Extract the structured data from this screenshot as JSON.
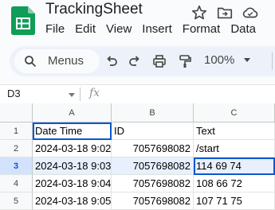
{
  "app": {
    "title": "TrackingSheet",
    "menu": [
      "File",
      "Edit",
      "View",
      "Insert",
      "Format",
      "Data"
    ],
    "header_icons": [
      "star-icon",
      "move-to-folder-icon",
      "cloud-status-icon"
    ]
  },
  "toolbar": {
    "search_label": "Menus",
    "buttons": [
      "undo-icon",
      "redo-icon",
      "print-icon",
      "paint-format-icon"
    ],
    "zoom": "100%"
  },
  "formula_bar": {
    "namebox": "D3",
    "fx": "fx"
  },
  "grid": {
    "columns": [
      "A",
      "B",
      "C"
    ],
    "row_numbers": [
      "1",
      "2",
      "3",
      "4",
      "5"
    ],
    "rows": [
      [
        "Date Time",
        "ID",
        "Text"
      ],
      [
        "2024-03-18 9:02",
        "7057698082",
        "/start"
      ],
      [
        "2024-03-18 9:03",
        "7057698082",
        "114 69 74"
      ],
      [
        "2024-03-18 9:04",
        "7057698082",
        "108 66 72"
      ],
      [
        "2024-03-18 9:05",
        "7057698082",
        "107 71 75"
      ]
    ],
    "active_cell": "D3"
  },
  "colors": {
    "accent": "#0b57d0",
    "logo_green": "#0f9d58",
    "toolbar_bg": "#edf2fa",
    "highlight_row": "#e8f0fe"
  }
}
